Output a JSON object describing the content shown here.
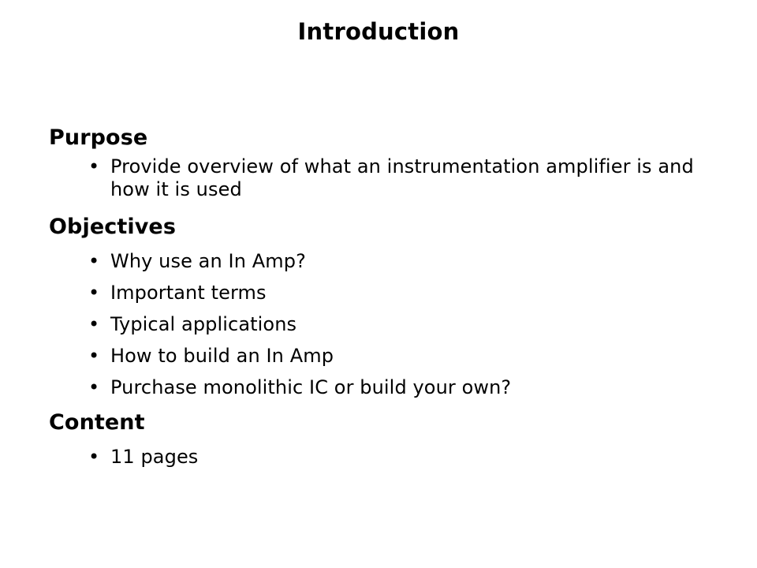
{
  "slide": {
    "title": "Introduction",
    "bullet_glyph": "•",
    "text_color": "#000000",
    "background_color": "#ffffff",
    "sections": [
      {
        "heading": "Purpose",
        "bullets": [
          "Provide overview of what an instrumentation amplifier is and how it is used"
        ]
      },
      {
        "heading": "Objectives",
        "bullets": [
          "Why use an In Amp?",
          "Important terms",
          "Typical applications",
          "How to build an In Amp",
          "Purchase monolithic IC or build your own?"
        ]
      },
      {
        "heading": "Content",
        "bullets": [
          "11 pages"
        ]
      }
    ]
  }
}
